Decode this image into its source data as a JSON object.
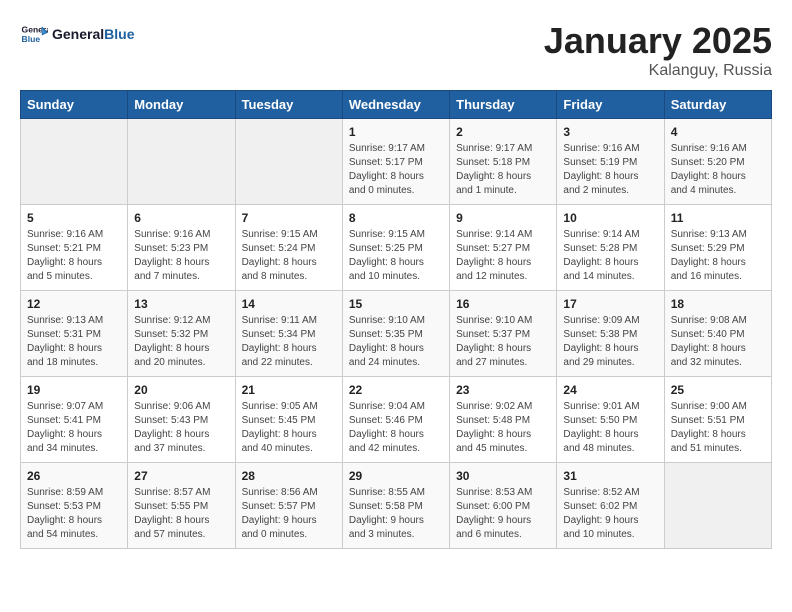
{
  "header": {
    "logo_general": "General",
    "logo_blue": "Blue",
    "month": "January 2025",
    "location": "Kalanguy, Russia"
  },
  "weekdays": [
    "Sunday",
    "Monday",
    "Tuesday",
    "Wednesday",
    "Thursday",
    "Friday",
    "Saturday"
  ],
  "weeks": [
    [
      {
        "day": "",
        "content": ""
      },
      {
        "day": "",
        "content": ""
      },
      {
        "day": "",
        "content": ""
      },
      {
        "day": "1",
        "content": "Sunrise: 9:17 AM\nSunset: 5:17 PM\nDaylight: 8 hours\nand 0 minutes."
      },
      {
        "day": "2",
        "content": "Sunrise: 9:17 AM\nSunset: 5:18 PM\nDaylight: 8 hours\nand 1 minute."
      },
      {
        "day": "3",
        "content": "Sunrise: 9:16 AM\nSunset: 5:19 PM\nDaylight: 8 hours\nand 2 minutes."
      },
      {
        "day": "4",
        "content": "Sunrise: 9:16 AM\nSunset: 5:20 PM\nDaylight: 8 hours\nand 4 minutes."
      }
    ],
    [
      {
        "day": "5",
        "content": "Sunrise: 9:16 AM\nSunset: 5:21 PM\nDaylight: 8 hours\nand 5 minutes."
      },
      {
        "day": "6",
        "content": "Sunrise: 9:16 AM\nSunset: 5:23 PM\nDaylight: 8 hours\nand 7 minutes."
      },
      {
        "day": "7",
        "content": "Sunrise: 9:15 AM\nSunset: 5:24 PM\nDaylight: 8 hours\nand 8 minutes."
      },
      {
        "day": "8",
        "content": "Sunrise: 9:15 AM\nSunset: 5:25 PM\nDaylight: 8 hours\nand 10 minutes."
      },
      {
        "day": "9",
        "content": "Sunrise: 9:14 AM\nSunset: 5:27 PM\nDaylight: 8 hours\nand 12 minutes."
      },
      {
        "day": "10",
        "content": "Sunrise: 9:14 AM\nSunset: 5:28 PM\nDaylight: 8 hours\nand 14 minutes."
      },
      {
        "day": "11",
        "content": "Sunrise: 9:13 AM\nSunset: 5:29 PM\nDaylight: 8 hours\nand 16 minutes."
      }
    ],
    [
      {
        "day": "12",
        "content": "Sunrise: 9:13 AM\nSunset: 5:31 PM\nDaylight: 8 hours\nand 18 minutes."
      },
      {
        "day": "13",
        "content": "Sunrise: 9:12 AM\nSunset: 5:32 PM\nDaylight: 8 hours\nand 20 minutes."
      },
      {
        "day": "14",
        "content": "Sunrise: 9:11 AM\nSunset: 5:34 PM\nDaylight: 8 hours\nand 22 minutes."
      },
      {
        "day": "15",
        "content": "Sunrise: 9:10 AM\nSunset: 5:35 PM\nDaylight: 8 hours\nand 24 minutes."
      },
      {
        "day": "16",
        "content": "Sunrise: 9:10 AM\nSunset: 5:37 PM\nDaylight: 8 hours\nand 27 minutes."
      },
      {
        "day": "17",
        "content": "Sunrise: 9:09 AM\nSunset: 5:38 PM\nDaylight: 8 hours\nand 29 minutes."
      },
      {
        "day": "18",
        "content": "Sunrise: 9:08 AM\nSunset: 5:40 PM\nDaylight: 8 hours\nand 32 minutes."
      }
    ],
    [
      {
        "day": "19",
        "content": "Sunrise: 9:07 AM\nSunset: 5:41 PM\nDaylight: 8 hours\nand 34 minutes."
      },
      {
        "day": "20",
        "content": "Sunrise: 9:06 AM\nSunset: 5:43 PM\nDaylight: 8 hours\nand 37 minutes."
      },
      {
        "day": "21",
        "content": "Sunrise: 9:05 AM\nSunset: 5:45 PM\nDaylight: 8 hours\nand 40 minutes."
      },
      {
        "day": "22",
        "content": "Sunrise: 9:04 AM\nSunset: 5:46 PM\nDaylight: 8 hours\nand 42 minutes."
      },
      {
        "day": "23",
        "content": "Sunrise: 9:02 AM\nSunset: 5:48 PM\nDaylight: 8 hours\nand 45 minutes."
      },
      {
        "day": "24",
        "content": "Sunrise: 9:01 AM\nSunset: 5:50 PM\nDaylight: 8 hours\nand 48 minutes."
      },
      {
        "day": "25",
        "content": "Sunrise: 9:00 AM\nSunset: 5:51 PM\nDaylight: 8 hours\nand 51 minutes."
      }
    ],
    [
      {
        "day": "26",
        "content": "Sunrise: 8:59 AM\nSunset: 5:53 PM\nDaylight: 8 hours\nand 54 minutes."
      },
      {
        "day": "27",
        "content": "Sunrise: 8:57 AM\nSunset: 5:55 PM\nDaylight: 8 hours\nand 57 minutes."
      },
      {
        "day": "28",
        "content": "Sunrise: 8:56 AM\nSunset: 5:57 PM\nDaylight: 9 hours\nand 0 minutes."
      },
      {
        "day": "29",
        "content": "Sunrise: 8:55 AM\nSunset: 5:58 PM\nDaylight: 9 hours\nand 3 minutes."
      },
      {
        "day": "30",
        "content": "Sunrise: 8:53 AM\nSunset: 6:00 PM\nDaylight: 9 hours\nand 6 minutes."
      },
      {
        "day": "31",
        "content": "Sunrise: 8:52 AM\nSunset: 6:02 PM\nDaylight: 9 hours\nand 10 minutes."
      },
      {
        "day": "",
        "content": ""
      }
    ]
  ]
}
